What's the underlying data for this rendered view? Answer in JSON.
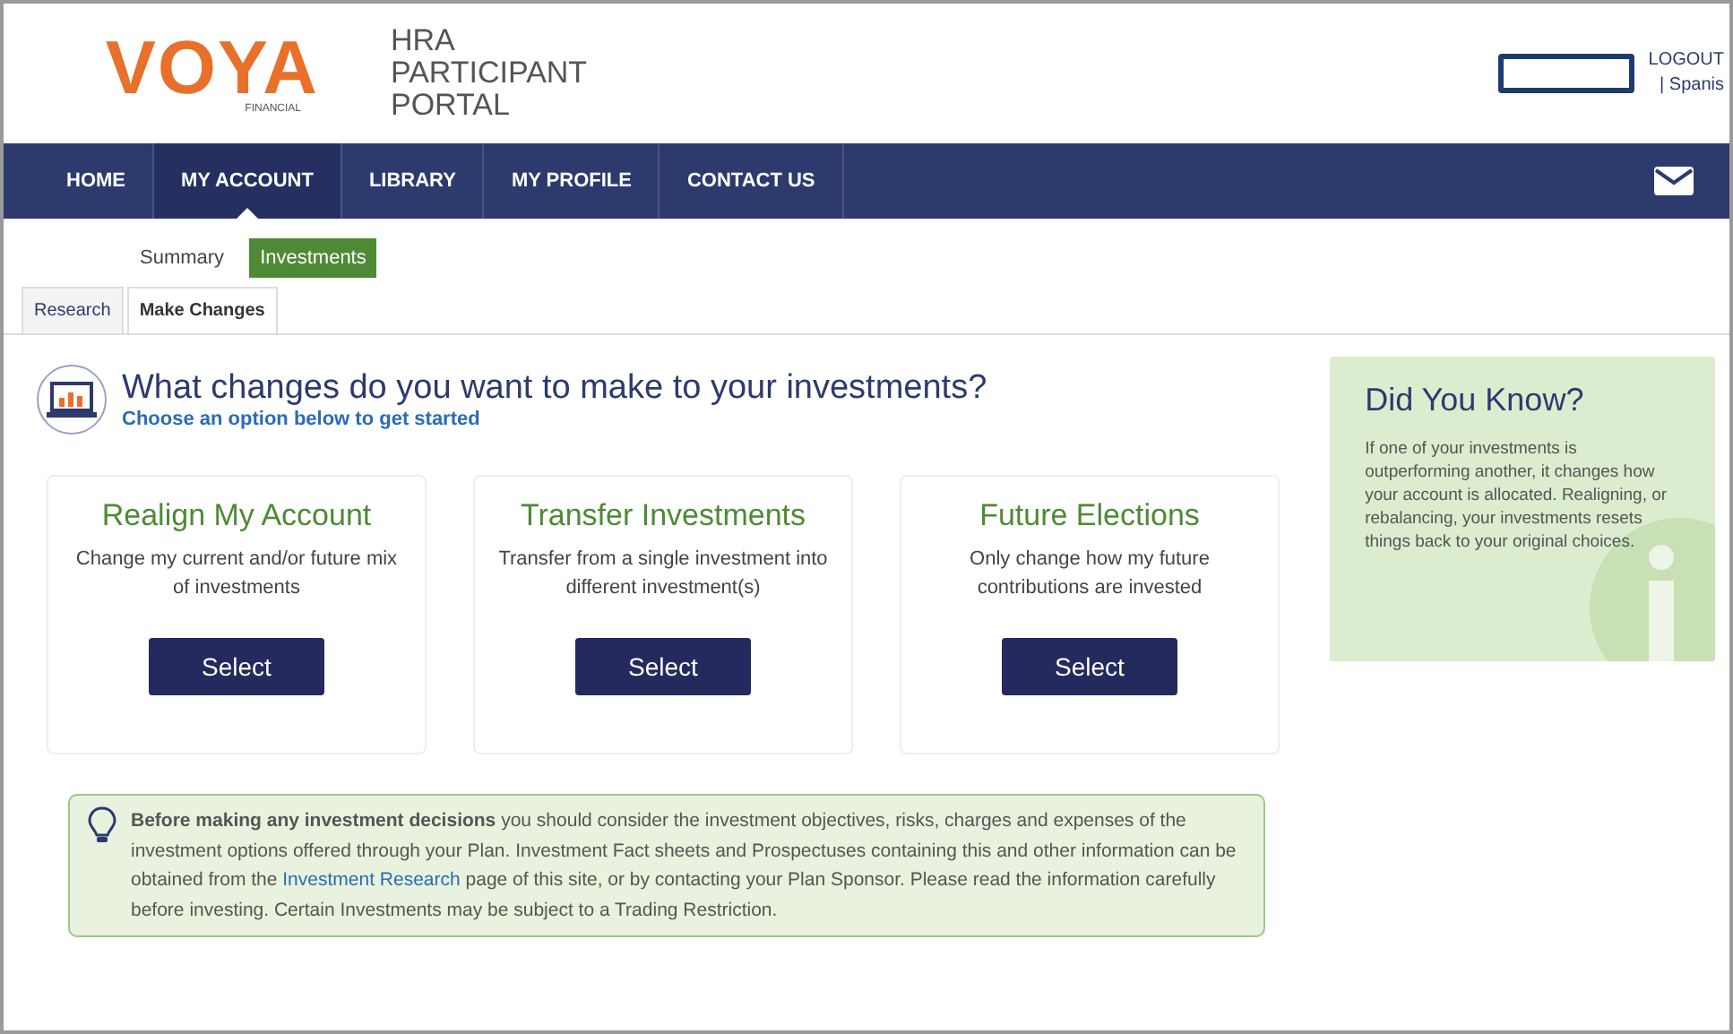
{
  "header": {
    "logo": {
      "wordmark": "VOYA",
      "tagline": "FINANCIAL"
    },
    "portal_title": [
      "HRA",
      "PARTICIPANT",
      "PORTAL"
    ],
    "logout": "LOGOUT",
    "language": "| Spanis"
  },
  "nav": [
    {
      "label": "HOME",
      "selected": false
    },
    {
      "label": "MY ACCOUNT",
      "selected": true
    },
    {
      "label": "LIBRARY",
      "selected": false
    },
    {
      "label": "MY PROFILE",
      "selected": false
    },
    {
      "label": "CONTACT US",
      "selected": false
    }
  ],
  "subnav": [
    {
      "label": "Summary",
      "selected": false
    },
    {
      "label": "Investments",
      "selected": true
    }
  ],
  "tabs": [
    {
      "label": "Research",
      "selected": false
    },
    {
      "label": "Make Changes",
      "selected": true
    }
  ],
  "heading": {
    "title": "What changes do you want to make to your investments?",
    "subtitle": "Choose an option below to get started"
  },
  "options": [
    {
      "title": "Realign My Account",
      "description": "Change my current and/or future mix of investments",
      "button": "Select"
    },
    {
      "title": "Transfer Investments",
      "description": "Transfer from a single investment into different investment(s)",
      "button": "Select"
    },
    {
      "title": "Future Elections",
      "description": "Only change how my future contributions are invested",
      "button": "Select"
    }
  ],
  "did_you_know": {
    "title": "Did You Know?",
    "text": "If one of your investments is outperforming another, it changes how your account is allocated. Realigning, or rebalancing, your investments resets things back to your original choices."
  },
  "disclaimer": {
    "before": "**Before making any investment decisions** you should consider the investment objectives, risks, charges and expenses of the investment options offered through your Plan. Investment Fact sheets and Prospectuses containing this and other information can be obtained from the",
    "link": "Investment Research",
    "after": "page of this site, or by contacting your Plan Sponsor. Please read the information carefully before investing. Certain Investments may be subject to a Trading Restriction."
  }
}
